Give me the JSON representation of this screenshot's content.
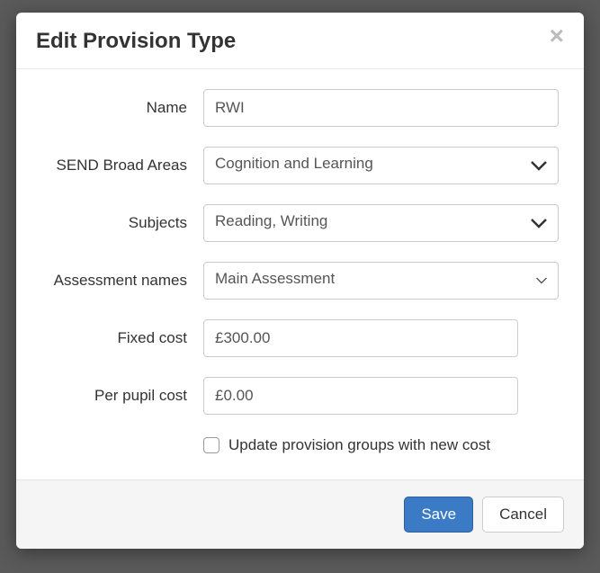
{
  "modal": {
    "title": "Edit Provision Type"
  },
  "form": {
    "name": {
      "label": "Name",
      "value": "RWI"
    },
    "broad_areas": {
      "label": "SEND Broad Areas",
      "value": "Cognition and Learning"
    },
    "subjects": {
      "label": "Subjects",
      "value": "Reading, Writing"
    },
    "assessment": {
      "label": "Assessment names",
      "value": "Main Assessment"
    },
    "fixed_cost": {
      "label": "Fixed cost",
      "value": "£300.00"
    },
    "per_pupil": {
      "label": "Per pupil cost",
      "value": "£0.00"
    },
    "update_groups": {
      "label": "Update provision groups with new cost",
      "checked": false
    }
  },
  "footer": {
    "save": "Save",
    "cancel": "Cancel"
  }
}
